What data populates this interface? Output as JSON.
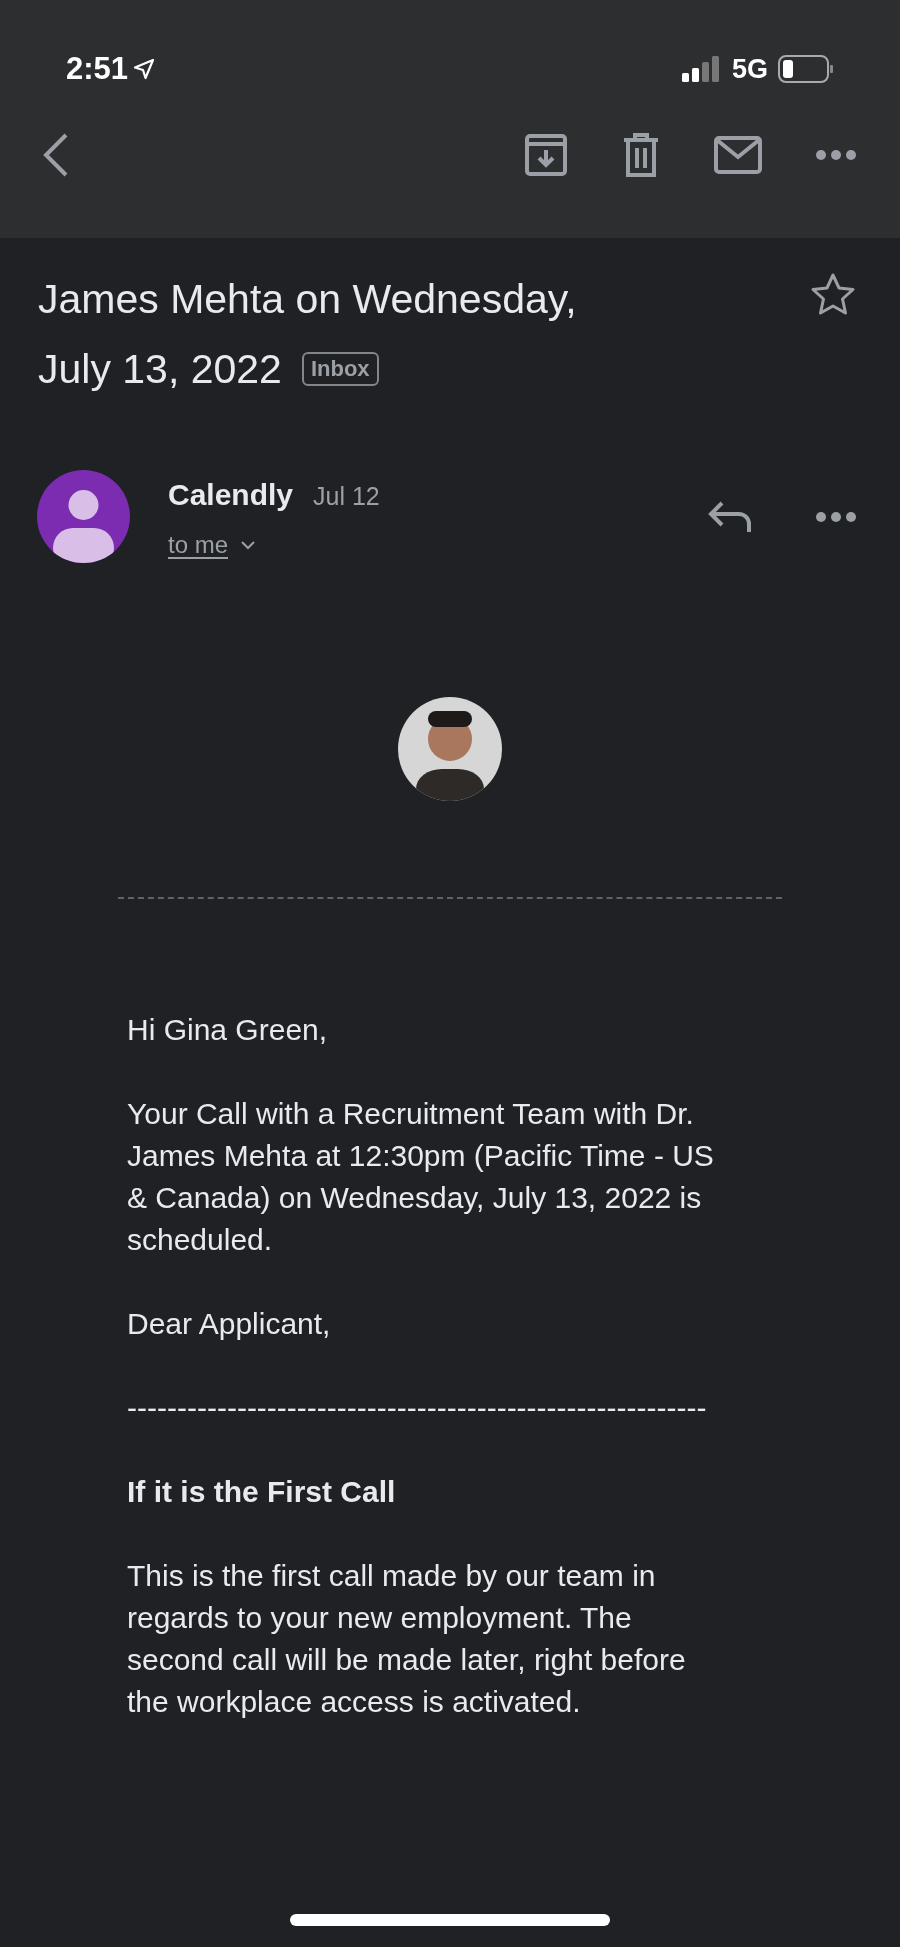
{
  "status_bar": {
    "time": "2:51",
    "network": "5G"
  },
  "subject": {
    "lines": [
      "James Mehta on Wednesday,",
      "July 13, 2022"
    ],
    "label": "Inbox",
    "starred": false
  },
  "message": {
    "sender": "Calendly",
    "date": "Jul 12",
    "recipient": "to me"
  },
  "body": [
    {
      "kind": "text",
      "text": "Hi Gina Green,"
    },
    {
      "kind": "text",
      "text": "Your Call with a Recruitment Team with Dr. James Mehta at 12:30pm (Pacific Time - US & Canada) on Wednesday, July 13, 2022 is scheduled."
    },
    {
      "kind": "text",
      "text": "Dear Applicant,"
    },
    {
      "kind": "text",
      "text": "----------------------------------------------------------"
    },
    {
      "kind": "heading",
      "text": "If it is the First Call"
    },
    {
      "kind": "text",
      "text": "This is the first call made by our team in regards to your new employment. The second call will be made later, right before the workplace access is activated."
    }
  ]
}
